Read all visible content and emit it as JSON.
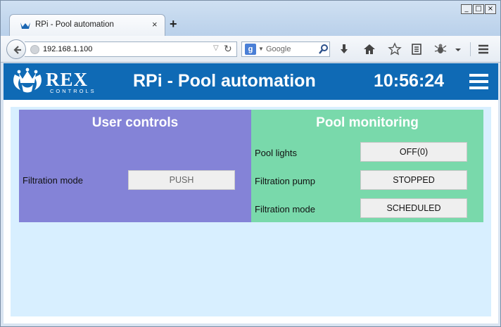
{
  "browser": {
    "tab_title": "RPi - Pool automation",
    "tab_close": "×",
    "new_tab": "+",
    "url": "192.168.1.100",
    "search_placeholder": "Google",
    "window_controls": {
      "minimize": "_",
      "maximize": "□",
      "close": "×"
    }
  },
  "app": {
    "logo_text": "REX",
    "logo_subtext": "CONTROLS",
    "title": "RPi - Pool automation",
    "clock": "10:56:24"
  },
  "user_controls": {
    "title": "User controls",
    "rows": [
      {
        "label": "Filtration mode",
        "button": "PUSH"
      }
    ]
  },
  "pool_monitoring": {
    "title": "Pool monitoring",
    "rows": [
      {
        "label": "Pool lights",
        "value": "OFF(0)"
      },
      {
        "label": "Filtration pump",
        "value": "STOPPED"
      },
      {
        "label": "Filtration mode",
        "value": "SCHEDULED"
      }
    ]
  },
  "colors": {
    "header": "#0f6ab5",
    "user_panel": "#8483d7",
    "pool_panel": "#79d9ab",
    "content_bg": "#d8efff"
  }
}
